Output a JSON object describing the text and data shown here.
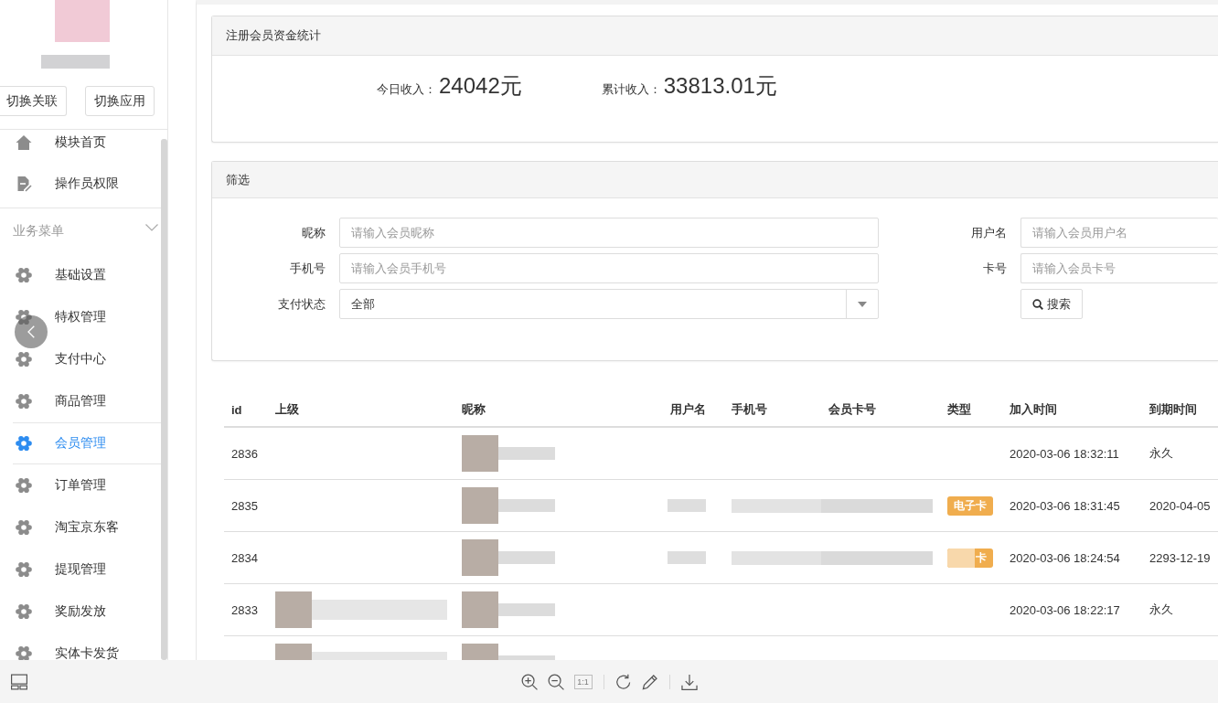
{
  "sidebar": {
    "buttons": [
      "切换关联",
      "切换应用"
    ],
    "items": [
      {
        "label": "模块首页",
        "kind": "home",
        "selected": false
      },
      {
        "label": "操作员权限",
        "kind": "document",
        "selected": false
      }
    ],
    "section": {
      "title": "业务菜单",
      "expanded": true,
      "items": [
        {
          "label": "基础设置",
          "kind": "gear",
          "selected": false
        },
        {
          "label": "特权管理",
          "kind": "gear",
          "selected": false
        },
        {
          "label": "支付中心",
          "kind": "gear",
          "selected": false
        },
        {
          "label": "商品管理",
          "kind": "gear",
          "selected": false
        },
        {
          "label": "会员管理",
          "kind": "gear",
          "selected": true
        },
        {
          "label": "订单管理",
          "kind": "gear",
          "selected": false
        },
        {
          "label": "淘宝京东客",
          "kind": "gear",
          "selected": false
        },
        {
          "label": "提现管理",
          "kind": "gear",
          "selected": false
        },
        {
          "label": "奖励发放",
          "kind": "gear",
          "selected": false
        },
        {
          "label": "实体卡发货",
          "kind": "gear",
          "selected": false
        }
      ]
    }
  },
  "stats_panel": {
    "title": "注册会员资金统计",
    "stats": [
      {
        "label": "今日收入：",
        "value": "24042元"
      },
      {
        "label": "累计收入：",
        "value": "33813.01元"
      }
    ]
  },
  "filter_panel": {
    "title": "筛选",
    "left_fields": [
      {
        "kind": "text",
        "label": "昵称",
        "placeholder": "请输入会员昵称"
      },
      {
        "kind": "text",
        "label": "手机号",
        "placeholder": "请输入会员手机号"
      },
      {
        "kind": "select",
        "label": "支付状态",
        "value": "全部"
      }
    ],
    "right_fields": [
      {
        "kind": "text",
        "label": "用户名",
        "placeholder": "请输入会员用户名"
      },
      {
        "kind": "text",
        "label": "卡号",
        "placeholder": "请输入会员卡号"
      }
    ],
    "search_button": "搜索"
  },
  "table": {
    "columns": [
      "id",
      "上级",
      "昵称",
      "用户名",
      "手机号",
      "会员卡号",
      "类型",
      "加入时间",
      "到期时间"
    ],
    "rows": [
      {
        "id": "2836",
        "parent_redacted": false,
        "nickname_redacted": true,
        "username_redacted": false,
        "phone_redacted": false,
        "card_redacted": false,
        "joined": "2020-03-06 18:32:11",
        "expires": "永久"
      },
      {
        "id": "2835",
        "parent_redacted": false,
        "nickname_redacted": true,
        "username_redacted": true,
        "phone_redacted": true,
        "card_redacted": true,
        "type": {
          "label": "电子卡",
          "obscured": false
        },
        "joined": "2020-03-06 18:31:45",
        "expires": "2020-04-05"
      },
      {
        "id": "2834",
        "parent_redacted": false,
        "nickname_redacted": true,
        "username_redacted": true,
        "phone_redacted": true,
        "card_redacted": true,
        "type": {
          "label": "卡",
          "obscured": true
        },
        "joined": "2020-03-06 18:24:54",
        "expires": "2293-12-19"
      },
      {
        "id": "2833",
        "parent_redacted": true,
        "nickname_redacted": true,
        "username_redacted": false,
        "phone_redacted": false,
        "card_redacted": false,
        "joined": "2020-03-06 18:22:17",
        "expires": "永久"
      },
      {
        "parent_redacted": true,
        "nickname_redacted": true,
        "username_redacted": false,
        "phone_redacted": false,
        "card_redacted": false
      }
    ]
  },
  "viewer_toolbar": {
    "actual_size": {
      "label": "1:1",
      "disabled": true
    }
  }
}
